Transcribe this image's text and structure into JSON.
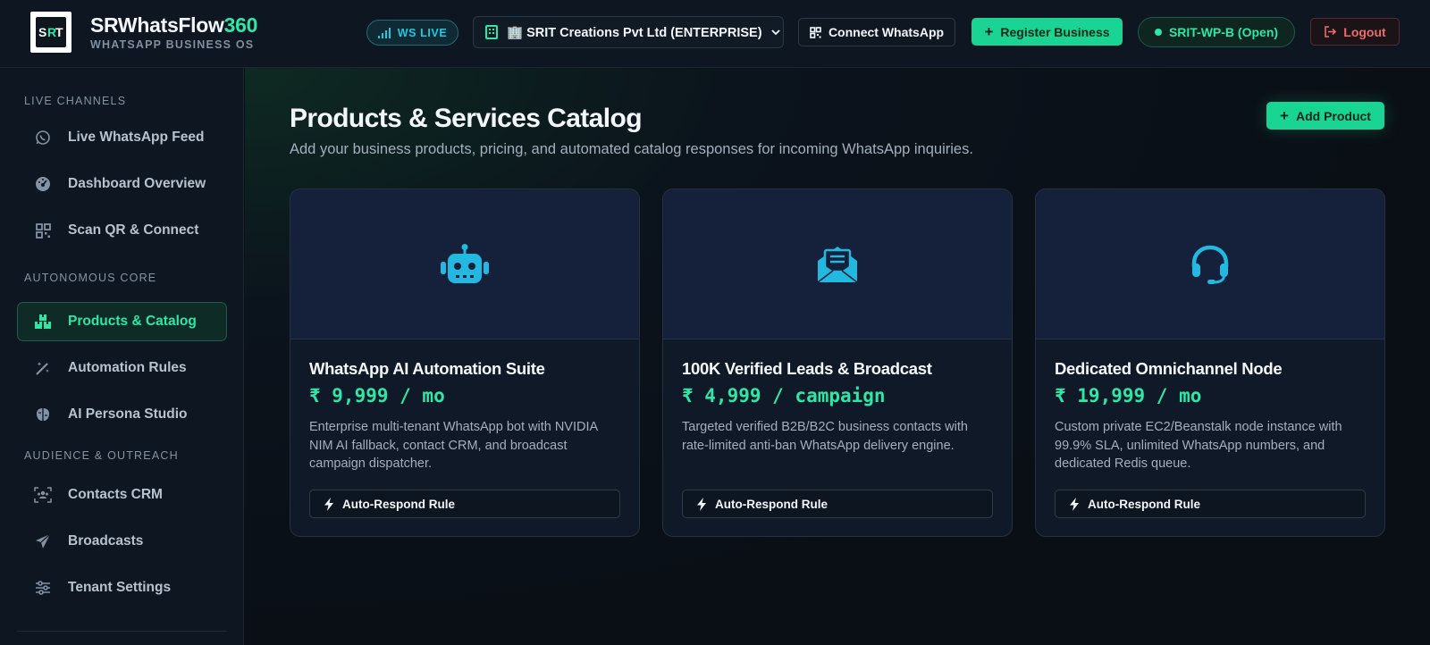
{
  "brand": {
    "name_main": "SRWhatsFlow",
    "name_accent": "360",
    "subtitle": "WHATSAPP BUSINESS OS",
    "logo_text": "SRIT"
  },
  "header": {
    "live_label": "WS LIVE",
    "tenant_label": "🏢 SRIT Creations Pvt Ltd (ENTERPRISE)",
    "connect_label": "Connect WhatsApp",
    "register_label": "Register Business",
    "session_label": "SRIT-WP-B (Open)",
    "logout_label": "Logout"
  },
  "sidebar": {
    "sections": [
      {
        "label": "LIVE CHANNELS"
      },
      {
        "label": "AUTONOMOUS CORE"
      },
      {
        "label": "AUDIENCE & OUTREACH"
      }
    ],
    "items": [
      {
        "label": "Live WhatsApp Feed",
        "icon": "whatsapp-icon"
      },
      {
        "label": "Dashboard Overview",
        "icon": "dashboard-icon"
      },
      {
        "label": "Scan QR & Connect",
        "icon": "qr-icon"
      },
      {
        "label": "Products & Catalog",
        "icon": "boxes-icon",
        "active": true
      },
      {
        "label": "Automation Rules",
        "icon": "magic-wand-icon"
      },
      {
        "label": "AI Persona Studio",
        "icon": "brain-icon"
      },
      {
        "label": "Contacts CRM",
        "icon": "users-icon"
      },
      {
        "label": "Broadcasts",
        "icon": "paper-plane-icon"
      },
      {
        "label": "Tenant Settings",
        "icon": "sliders-icon"
      }
    ]
  },
  "main": {
    "title": "Products & Services Catalog",
    "subtitle": "Add your business products, pricing, and automated catalog responses for incoming WhatsApp inquiries.",
    "add_label": "Add Product",
    "products": [
      {
        "title": "WhatsApp AI Automation Suite",
        "price": "₹ 9,999 / mo",
        "description": "Enterprise multi-tenant WhatsApp bot with NVIDIA NIM AI fallback, contact CRM, and broadcast campaign dispatcher.",
        "rule_label": "Auto-Respond Rule",
        "icon": "robot-icon"
      },
      {
        "title": "100K Verified Leads & Broadcast",
        "price": "₹ 4,999 / campaign",
        "description": "Targeted verified B2B/B2C business contacts with rate-limited anti-ban WhatsApp delivery engine.",
        "rule_label": "Auto-Respond Rule",
        "icon": "envelope-open-icon"
      },
      {
        "title": "Dedicated Omnichannel Node",
        "price": "₹ 19,999 / mo",
        "description": "Custom private EC2/Beanstalk node instance with 99.9% SLA, unlimited WhatsApp numbers, and dedicated Redis queue.",
        "rule_label": "Auto-Respond Rule",
        "icon": "headset-icon"
      }
    ]
  },
  "colors": {
    "accent": "#2ee6a6",
    "button_green": "#19d492",
    "cyan": "#22b8e0",
    "danger": "#ef6b6b"
  }
}
